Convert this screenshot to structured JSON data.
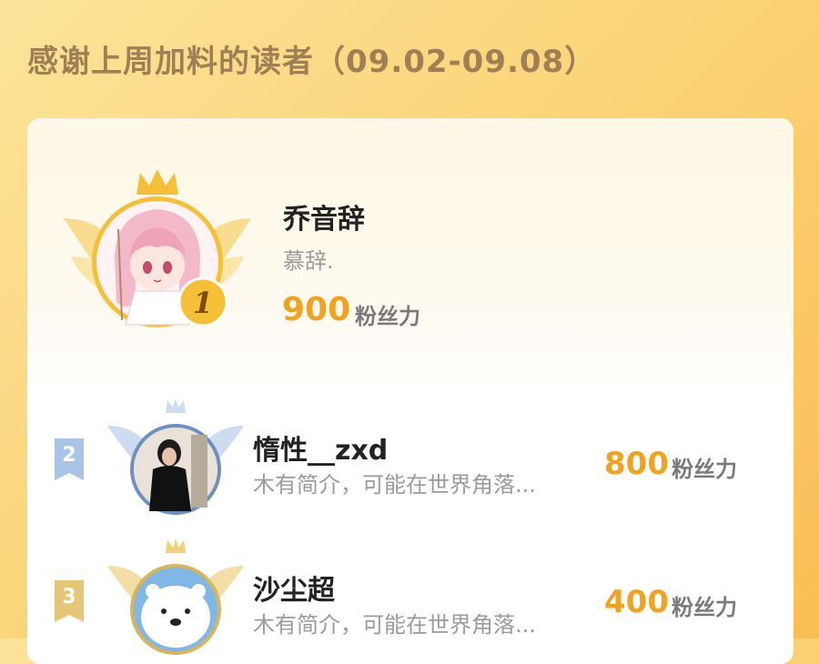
{
  "page": {
    "title": "感谢上周加料的读者（09.02-09.08）"
  },
  "leaderboard": [
    {
      "rank": "1",
      "name": "乔音辞",
      "bio": "慕辞.",
      "fans": "900",
      "unit": "粉丝力",
      "avatar_icon": "anime-girl-avatar-icon",
      "badge_color": "#f5c036"
    },
    {
      "rank": "2",
      "name": "惰性__zxd",
      "bio": "木有简介，可能在世界角落...",
      "fans": "800",
      "unit": "粉丝力",
      "avatar_icon": "woman-photo-avatar-icon",
      "badge_color": "#a9c4e6"
    },
    {
      "rank": "3",
      "name": "沙尘超",
      "bio": "木有简介，可能在世界角落...",
      "fans": "400",
      "unit": "粉丝力",
      "avatar_icon": "polar-bear-avatar-icon",
      "badge_color": "#e6c777"
    }
  ],
  "colors": {
    "accent_number": "#f0a31f",
    "title_text": "#a07f55",
    "gold": "#f5c036",
    "silver": "#a9c4e6",
    "bronze": "#e6c777"
  }
}
